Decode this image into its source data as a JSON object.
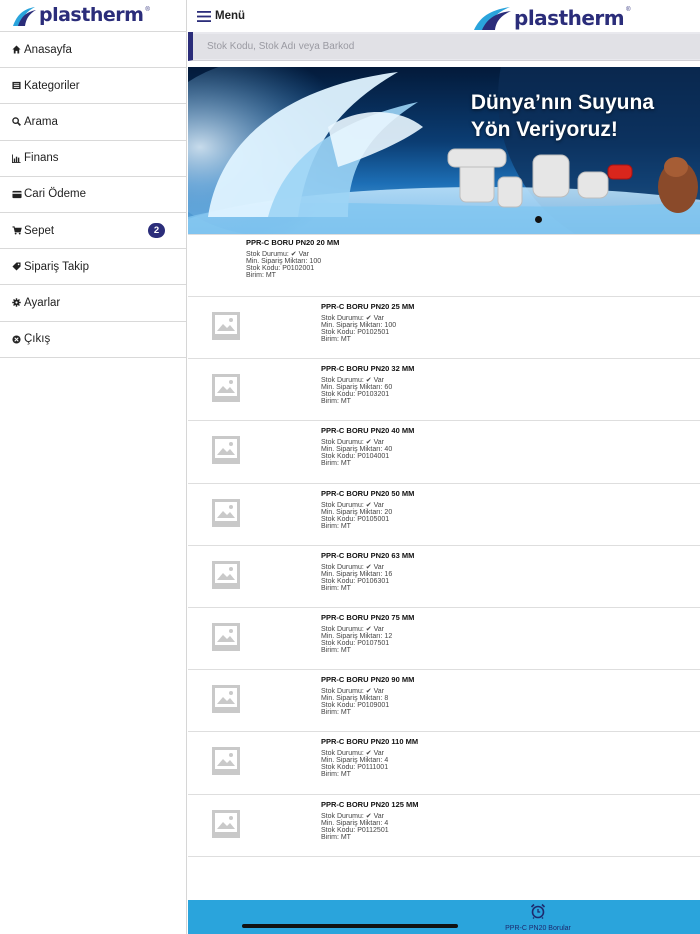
{
  "brand": {
    "name": "plastherm",
    "reg": "®"
  },
  "sidebar": {
    "items": [
      {
        "label": "Anasayfa"
      },
      {
        "label": "Kategoriler"
      },
      {
        "label": "Arama"
      },
      {
        "label": "Finans"
      },
      {
        "label": "Cari Ödeme"
      },
      {
        "label": "Sepet",
        "badge": "2"
      },
      {
        "label": "Sipariş Takip"
      },
      {
        "label": "Ayarlar"
      },
      {
        "label": "Çıkış"
      }
    ]
  },
  "header": {
    "menu_label": "Menü"
  },
  "search": {
    "placeholder": "Stok Kodu, Stok Adı veya Barkod"
  },
  "banner": {
    "line1": "Dünya’nın Suyuna",
    "line2": "Yön  Veriyoruz!"
  },
  "labels": {
    "stock": "Stok Durumu:",
    "stock_value": "Var",
    "min": "Min. Sipariş Miktarı:",
    "code": "Stok Kodu:",
    "unit": "Birim:"
  },
  "products": [
    {
      "title": "PPR-C BORU PN20 20 MM",
      "min": "100",
      "code": "P0102001",
      "unit": "MT"
    },
    {
      "title": "PPR-C BORU PN20 25 MM",
      "min": "100",
      "code": "P0102501",
      "unit": "MT"
    },
    {
      "title": "PPR-C BORU PN20 32 MM",
      "min": "60",
      "code": "P0103201",
      "unit": "MT"
    },
    {
      "title": "PPR-C BORU PN20 40 MM",
      "min": "40",
      "code": "P0104001",
      "unit": "MT"
    },
    {
      "title": "PPR-C BORU PN20 50 MM",
      "min": "20",
      "code": "P0105001",
      "unit": "MT"
    },
    {
      "title": "PPR-C BORU PN20 63 MM",
      "min": "16",
      "code": "P0106301",
      "unit": "MT"
    },
    {
      "title": "PPR-C BORU PN20 75 MM",
      "min": "12",
      "code": "P0107501",
      "unit": "MT"
    },
    {
      "title": "PPR-C BORU PN20 90 MM",
      "min": "8",
      "code": "P0109001",
      "unit": "MT"
    },
    {
      "title": "PPR-C BORU PN20 110 MM",
      "min": "4",
      "code": "P0111001",
      "unit": "MT"
    },
    {
      "title": "PPR-C BORU PN20 125 MM",
      "min": "4",
      "code": "P0112501",
      "unit": "MT"
    }
  ],
  "bottom_tab": {
    "label": "PPR-C PN20 Borular",
    "icon": "alarm-clock-icon"
  },
  "colors": {
    "brand": "#2b2d7a",
    "accent": "#2aa4dc"
  }
}
